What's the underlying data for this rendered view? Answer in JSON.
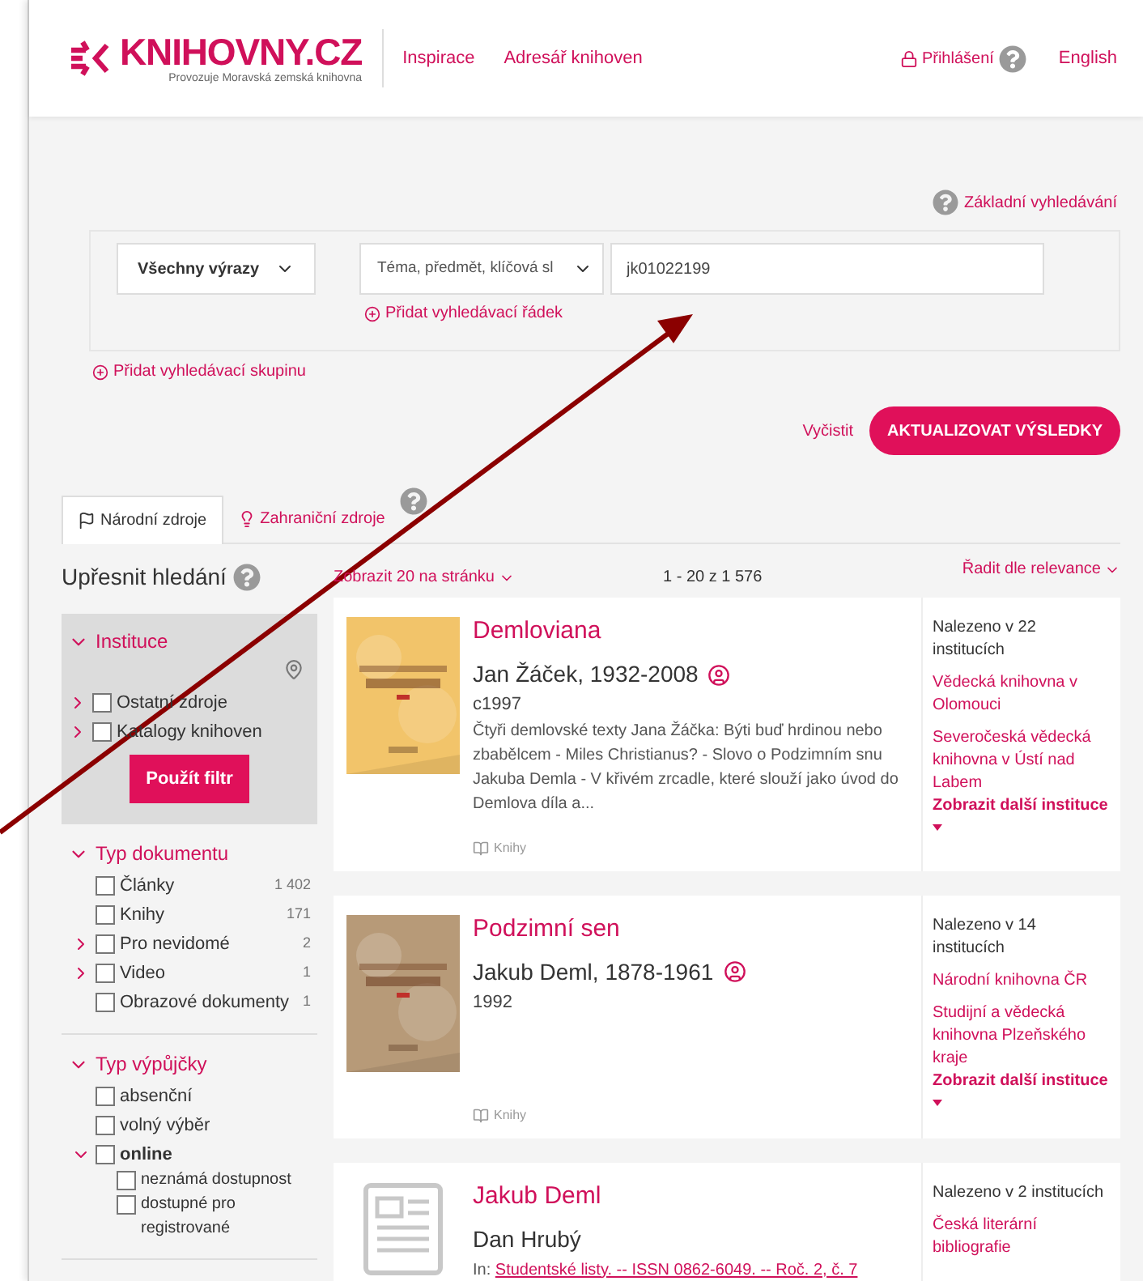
{
  "header": {
    "logo": "KNIHOVNY.CZ",
    "tagline": "Provozuje Moravská zemská knihovna",
    "nav": [
      "Inspirace",
      "Adresář knihoven"
    ],
    "login": "Přihlášení",
    "language": "English"
  },
  "search": {
    "basic_search_link": "Základní vyhledávání",
    "match_select": "Všechny výrazy",
    "field_select": "Téma, předmět, klíčová sl",
    "query": "jk01022199",
    "add_row": "Přidat vyhledávací řádek",
    "add_group": "Přidat vyhledávací skupinu",
    "clear": "Vyčistit",
    "submit": "AKTUALIZOVAT VÝSLEDKY"
  },
  "tabs": [
    {
      "label": "Národní zdroje",
      "selected": true,
      "kind": "flag"
    },
    {
      "label": "Zahraniční zdroje",
      "selected": false,
      "kind": "bulb"
    }
  ],
  "results_bar": {
    "page_size": "Zobrazit 20 na stránku",
    "range": "1 - 20 z 1 576",
    "sort": "Řadit dle relevance"
  },
  "sidebar": {
    "title": "Upřesnit hledání",
    "facets": [
      {
        "title": "Instituce",
        "expanded": true,
        "kind": "institution",
        "button": "Použít filtr",
        "items": [
          {
            "label": "Ostatní zdroje",
            "checked": false,
            "expanded": false
          },
          {
            "label": "Katalogy knihoven",
            "checked": false,
            "expanded": false
          }
        ]
      },
      {
        "title": "Typ dokumentu",
        "expanded": true,
        "kind": "plain",
        "items": [
          {
            "label": "Články",
            "count": "1 402",
            "checked": false
          },
          {
            "label": "Knihy",
            "count": "171",
            "checked": false
          },
          {
            "label": "Pro nevidomé",
            "count": "2",
            "checked": false,
            "expanded": false
          },
          {
            "label": "Video",
            "count": "1",
            "checked": false,
            "expanded": false
          },
          {
            "label": "Obrazové dokumenty",
            "count": "1",
            "checked": false
          }
        ]
      },
      {
        "title": "Typ výpůjčky",
        "expanded": true,
        "kind": "plain",
        "items": [
          {
            "label": "absenční",
            "checked": false
          },
          {
            "label": "volný výběr",
            "checked": false
          },
          {
            "label": "online",
            "checked": false,
            "expanded": true,
            "children": [
              {
                "label": "neznámá dostupnost",
                "checked": false
              },
              {
                "label": "dostupné pro registrované",
                "checked": false
              }
            ]
          }
        ]
      }
    ]
  },
  "results": [
    {
      "kind": "picture",
      "title": "Demloviana",
      "author": "Jan Žáček, 1932-2008",
      "year": "c1997",
      "description": "Čtyři demlovské texty Jana Žáčka: Býti buď hrdinou nebo zbabělcem - Miles Christianus? - Slovo o Podzimním snu Jakuba Demla - V křivém zrcadle, které slouží jako úvod do Demlova díla a...",
      "type": "Knihy",
      "found": "Nalezeno v 22 institucích",
      "institutions": [
        "Vědecká knihovna v Olomouci",
        "Severočeská vědecká knihovna v Ústí nad Labem"
      ],
      "more": "Zobrazit další instituce"
    },
    {
      "kind": "picture",
      "title": "Podzimní sen",
      "author": "Jakub Deml, 1878-1961",
      "year": "1992",
      "type": "Knihy",
      "found": "Nalezeno v 14 institucích",
      "institutions": [
        "Národní knihovna ČR",
        "Studijní a vědecká knihovna Plzeňského kraje"
      ],
      "more": "Zobrazit další instituce"
    },
    {
      "kind": "placeholder",
      "title": "Jakub Deml",
      "author": "Dan Hrubý",
      "in_label": "In:",
      "in_source": "Studentské listy. -- ISSN 0862-6049. -- Roč. 2, č. 7",
      "found": "Nalezeno v 2 institucích",
      "institutions": [
        "Česká literární bibliografie"
      ]
    }
  ]
}
